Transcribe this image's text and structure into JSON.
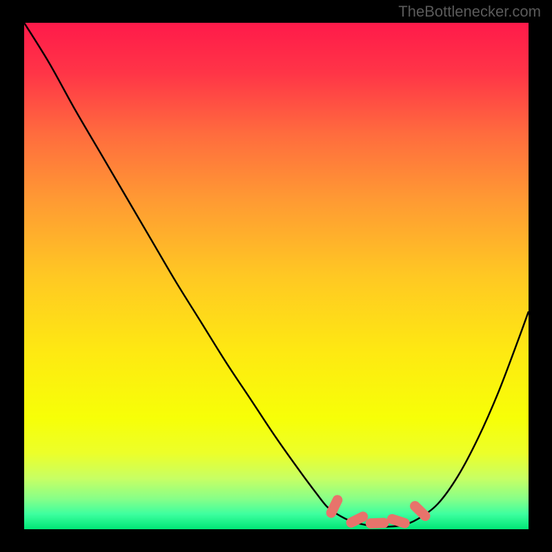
{
  "watermark": "TheBottlenecker.com",
  "chart_data": {
    "type": "line",
    "title": "",
    "xlabel": "",
    "ylabel": "",
    "xlim": [
      0,
      100
    ],
    "ylim": [
      0,
      100
    ],
    "background": {
      "type": "vertical-gradient",
      "stops": [
        {
          "offset": 0.0,
          "color": "#ff1a4a"
        },
        {
          "offset": 0.1,
          "color": "#ff3547"
        },
        {
          "offset": 0.22,
          "color": "#ff6c3e"
        },
        {
          "offset": 0.35,
          "color": "#ff9a33"
        },
        {
          "offset": 0.5,
          "color": "#ffc823"
        },
        {
          "offset": 0.65,
          "color": "#fee912"
        },
        {
          "offset": 0.78,
          "color": "#f7ff07"
        },
        {
          "offset": 0.85,
          "color": "#ecff2a"
        },
        {
          "offset": 0.9,
          "color": "#c7ff64"
        },
        {
          "offset": 0.94,
          "color": "#87ff88"
        },
        {
          "offset": 0.97,
          "color": "#3dff9f"
        },
        {
          "offset": 1.0,
          "color": "#00e676"
        }
      ]
    },
    "series": [
      {
        "name": "curve",
        "color": "#000000",
        "stroke_width": 2.5,
        "x": [
          0,
          5,
          10,
          15,
          20,
          25,
          30,
          35,
          40,
          45,
          50,
          55,
          58,
          60,
          62,
          65,
          68,
          70,
          72,
          75,
          78,
          82,
          86,
          90,
          94,
          98,
          100
        ],
        "y": [
          100,
          92,
          83,
          74.5,
          66,
          57.5,
          49,
          41,
          33,
          25.5,
          18,
          11,
          7,
          4.5,
          3,
          1.5,
          0.8,
          0.5,
          0.5,
          0.8,
          2,
          5,
          10.5,
          18,
          27,
          37.5,
          43
        ]
      }
    ],
    "markers": {
      "name": "bottleneck-range",
      "color": "#e8736b",
      "shape": "rounded-rect",
      "points": [
        {
          "cx": 61.5,
          "cy": 4.5,
          "w": 2.0,
          "h": 4.8,
          "rot": 26
        },
        {
          "cx": 66.0,
          "cy": 1.9,
          "w": 2.0,
          "h": 4.6,
          "rot": 63
        },
        {
          "cx": 70.0,
          "cy": 1.2,
          "w": 2.0,
          "h": 4.6,
          "rot": 88
        },
        {
          "cx": 74.2,
          "cy": 1.6,
          "w": 2.0,
          "h": 4.6,
          "rot": 108
        },
        {
          "cx": 78.5,
          "cy": 3.6,
          "w": 2.0,
          "h": 4.8,
          "rot": 134
        }
      ]
    }
  }
}
